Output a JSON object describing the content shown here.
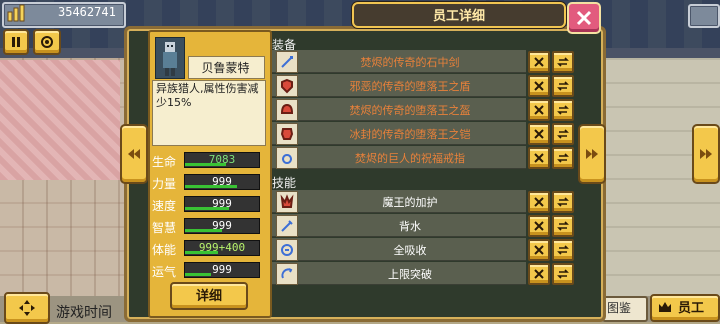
{
  "hud": {
    "money": "35462741",
    "game_time_label": "游戏时间"
  },
  "title": "员工详细",
  "character": {
    "name": "贝鲁蒙特",
    "description": "异族猎人,属性伤害减少15%",
    "stats": [
      {
        "label": "生命",
        "value": "7083",
        "fill": 0.55
      },
      {
        "label": "力量",
        "value": "999",
        "fill": 0.7
      },
      {
        "label": "速度",
        "value": "999",
        "fill": 0.6
      },
      {
        "label": "智慧",
        "value": "999",
        "fill": 0.5
      },
      {
        "label": "体能",
        "value": "999+400",
        "fill": 0.45
      },
      {
        "label": "运气",
        "value": "999",
        "fill": 0.35
      }
    ],
    "detail_button": "详细"
  },
  "equipment": {
    "header": "装备",
    "items": [
      {
        "name": "焚烬的传奇的石中剑",
        "icon": "sword-icon",
        "color": "#e8813a"
      },
      {
        "name": "邪恶的传奇的堕落王之盾",
        "icon": "shield-icon",
        "color": "#e8813a"
      },
      {
        "name": "焚烬的传奇的堕落王之盔",
        "icon": "helmet-icon",
        "color": "#e8813a"
      },
      {
        "name": "冰封的传奇的堕落王之铠",
        "icon": "armor-icon",
        "color": "#e8813a"
      },
      {
        "name": "焚烬的巨人的祝福戒指",
        "icon": "ring-icon",
        "color": "#e8813a"
      }
    ]
  },
  "skills": {
    "header": "技能",
    "items": [
      {
        "name": "魔王的加护",
        "icon": "demon-king-icon",
        "color": "#ffffff"
      },
      {
        "name": "背水",
        "icon": "sword-water-icon",
        "color": "#ffffff"
      },
      {
        "name": "全吸收",
        "icon": "absorb-icon",
        "color": "#ffffff"
      },
      {
        "name": "上限突破",
        "icon": "limit-break-icon",
        "color": "#ffffff"
      }
    ]
  },
  "bottom": {
    "book_label": "图鉴",
    "staff_label": "员工"
  },
  "colors": {
    "accent_gold": "#f3c84b",
    "close_pink": "#e25b7e",
    "panel": "#2f3a2c",
    "stat_bar": "#39c234"
  }
}
